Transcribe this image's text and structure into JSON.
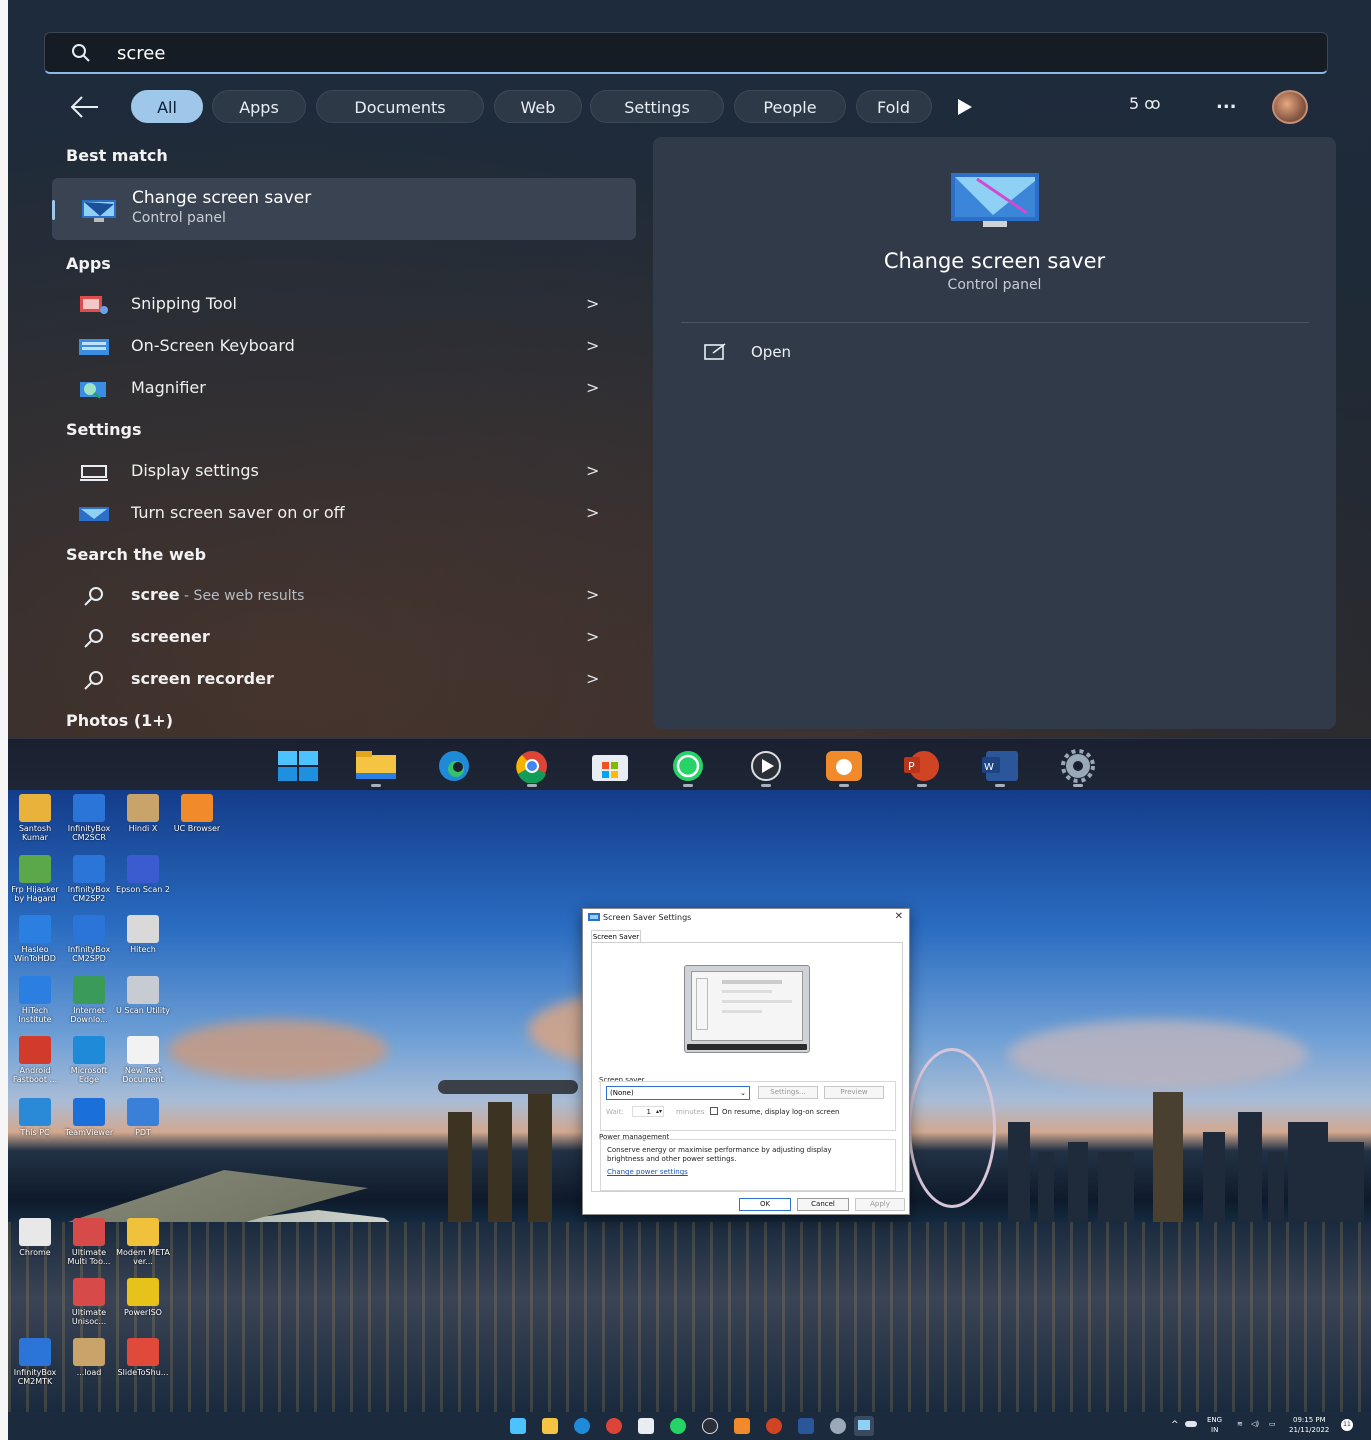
{
  "search": {
    "query": "scree",
    "filters": [
      "All",
      "Apps",
      "Documents",
      "Web",
      "Settings",
      "People",
      "Fold"
    ],
    "points": "5",
    "more": "..."
  },
  "best_match": {
    "heading": "Best match",
    "title": "Change screen saver",
    "subtitle": "Control panel"
  },
  "apps": {
    "heading": "Apps",
    "items": [
      "Snipping Tool",
      "On-Screen Keyboard",
      "Magnifier"
    ]
  },
  "settings": {
    "heading": "Settings",
    "items": [
      "Display settings",
      "Turn screen saver on or off"
    ]
  },
  "web": {
    "heading": "Search the web",
    "items": [
      {
        "label": "scree",
        "suffix": " - See web results"
      },
      {
        "label": "screener",
        "suffix": ""
      },
      {
        "label": "screen recorder",
        "suffix": ""
      }
    ]
  },
  "photos": {
    "heading": "Photos (1+)"
  },
  "preview": {
    "title": "Change screen saver",
    "subtitle": "Control panel",
    "open_label": "Open"
  },
  "desktop_icons": [
    {
      "label": "Santosh Kumar",
      "color": "#e9b23b"
    },
    {
      "label": "InfinityBox CM2SCR",
      "color": "#2b74d8"
    },
    {
      "label": "Hindi X",
      "color": "#c9a46a"
    },
    {
      "label": "UC Browser",
      "color": "#f08a2a"
    },
    {
      "label": "Frp Hijacker by Hagard",
      "color": "#5aa84a"
    },
    {
      "label": "InfinityBox CM2SP2",
      "color": "#2b74d8"
    },
    {
      "label": "Epson Scan 2",
      "color": "#3b5bd0"
    },
    {
      "label": "Hasleo WinToHDD",
      "color": "#2a7fe0"
    },
    {
      "label": "InfinityBox CM2SPD",
      "color": "#2b74d8"
    },
    {
      "label": "Hitech",
      "color": "#d9d9d9"
    },
    {
      "label": "HiTech Institute",
      "color": "#2a7fe0"
    },
    {
      "label": "Internet Downlo...",
      "color": "#3a9a5a"
    },
    {
      "label": "U Scan Utility",
      "color": "#c7cbd2"
    },
    {
      "label": "Android Fastboot ...",
      "color": "#d13b2b"
    },
    {
      "label": "Microsoft Edge",
      "color": "#1f8ad8"
    },
    {
      "label": "New Text Document",
      "color": "#f2f2f2"
    },
    {
      "label": "This PC",
      "color": "#2a8ad8"
    },
    {
      "label": "TeamViewer",
      "color": "#1a6fd8"
    },
    {
      "label": "PDT",
      "color": "#3a7fd8"
    },
    {
      "label": "Chrome",
      "color": "#e8e8e8"
    },
    {
      "label": "Ultimate Multi Too...",
      "color": "#d64a4a"
    },
    {
      "label": "Modem META ver...",
      "color": "#f0c23b"
    },
    {
      "label": "Ultimate Unisoc...",
      "color": "#d64a4a"
    },
    {
      "label": "PowerISO",
      "color": "#e6c21a"
    },
    {
      "label": "InfinityBox CM2MTK",
      "color": "#2b74d8"
    },
    {
      "label": "...load",
      "color": "#c9a46a"
    },
    {
      "label": "SlideToShu...",
      "color": "#e04a3b"
    }
  ],
  "dialog": {
    "title": "Screen Saver Settings",
    "close": "✕",
    "tab": "Screen Saver",
    "screen_saver_label": "Screen saver",
    "selected": "(None)",
    "settings_btn": "Settings...",
    "preview_btn": "Preview",
    "wait_label": "Wait:",
    "wait_value": "1",
    "minutes_label": "minutes",
    "resume_label": "On resume, display log-on screen",
    "power_heading": "Power management",
    "power_text": "Conserve energy or maximise performance by adjusting display brightness and other power settings.",
    "power_link": "Change power settings",
    "ok": "OK",
    "cancel": "Cancel",
    "apply": "Apply"
  },
  "tray": {
    "lang": "ENG",
    "region": "IN",
    "time": "09:15 PM",
    "date": "21/11/2022",
    "notif": "11"
  },
  "colors": {
    "accent": "#9fc7ea",
    "panel": "#1f2a36",
    "preview": "#303a48",
    "taskbar": "#1b2a3c"
  }
}
